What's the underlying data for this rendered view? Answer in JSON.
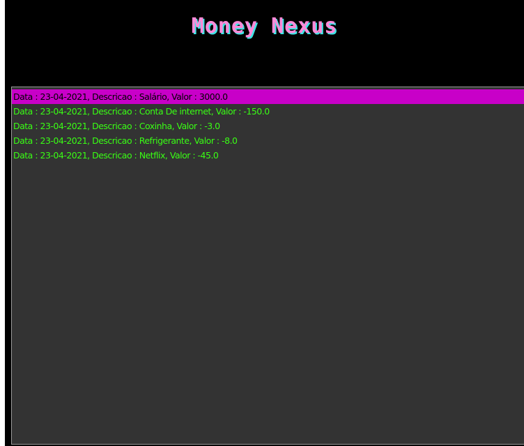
{
  "app": {
    "title": "Money Nexus"
  },
  "transactions": {
    "selected_index": 0,
    "items": [
      {
        "label": "Data : 23-04-2021, Descricao : Salário, Valor : 3000.0"
      },
      {
        "label": "Data : 23-04-2021, Descricao : Conta De internet, Valor : -150.0"
      },
      {
        "label": "Data : 23-04-2021, Descricao : Coxinha, Valor : -3.0"
      },
      {
        "label": "Data : 23-04-2021, Descricao : Refrigerante, Valor : -8.0"
      },
      {
        "label": "Data : 23-04-2021, Descricao : Netflix, Valor : -45.0"
      }
    ]
  },
  "colors": {
    "background": "#000000",
    "list_background": "#333333",
    "item_text": "#39ff14",
    "selected_background": "#c800c8",
    "selected_text": "#000000",
    "title_pink": "#ff8ad8",
    "title_cyan": "#3ee6e6"
  }
}
